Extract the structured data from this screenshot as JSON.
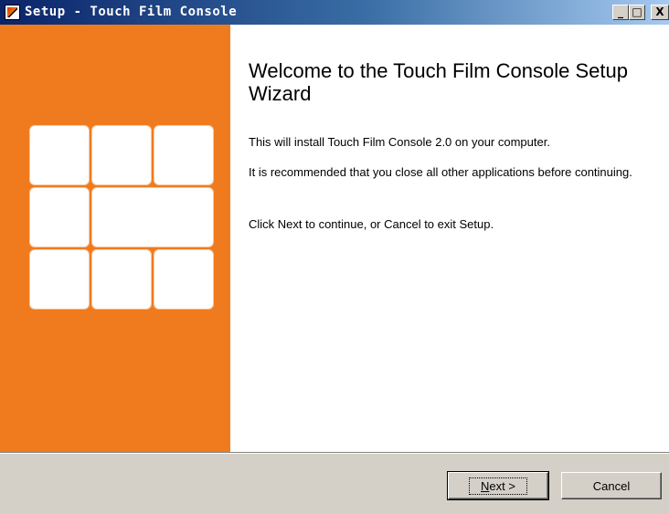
{
  "window": {
    "title": "Setup - Touch Film Console",
    "buttons": {
      "minimize": "_",
      "maximize": "□",
      "close": "X"
    }
  },
  "sidebar": {
    "background_color": "#f07b1e",
    "tile_color": "#ffffff",
    "logo": "grid-logo"
  },
  "content": {
    "heading": "Welcome to the Touch Film Console Setup Wizard",
    "paragraph1": "This will install Touch Film Console 2.0 on your computer.",
    "paragraph2": "It is recommended that you close all other applications before continuing.",
    "paragraph3": "Click Next to continue, or Cancel to exit Setup."
  },
  "footer": {
    "next_mnemonic": "N",
    "next_rest": "ext >",
    "cancel_label": "Cancel"
  }
}
